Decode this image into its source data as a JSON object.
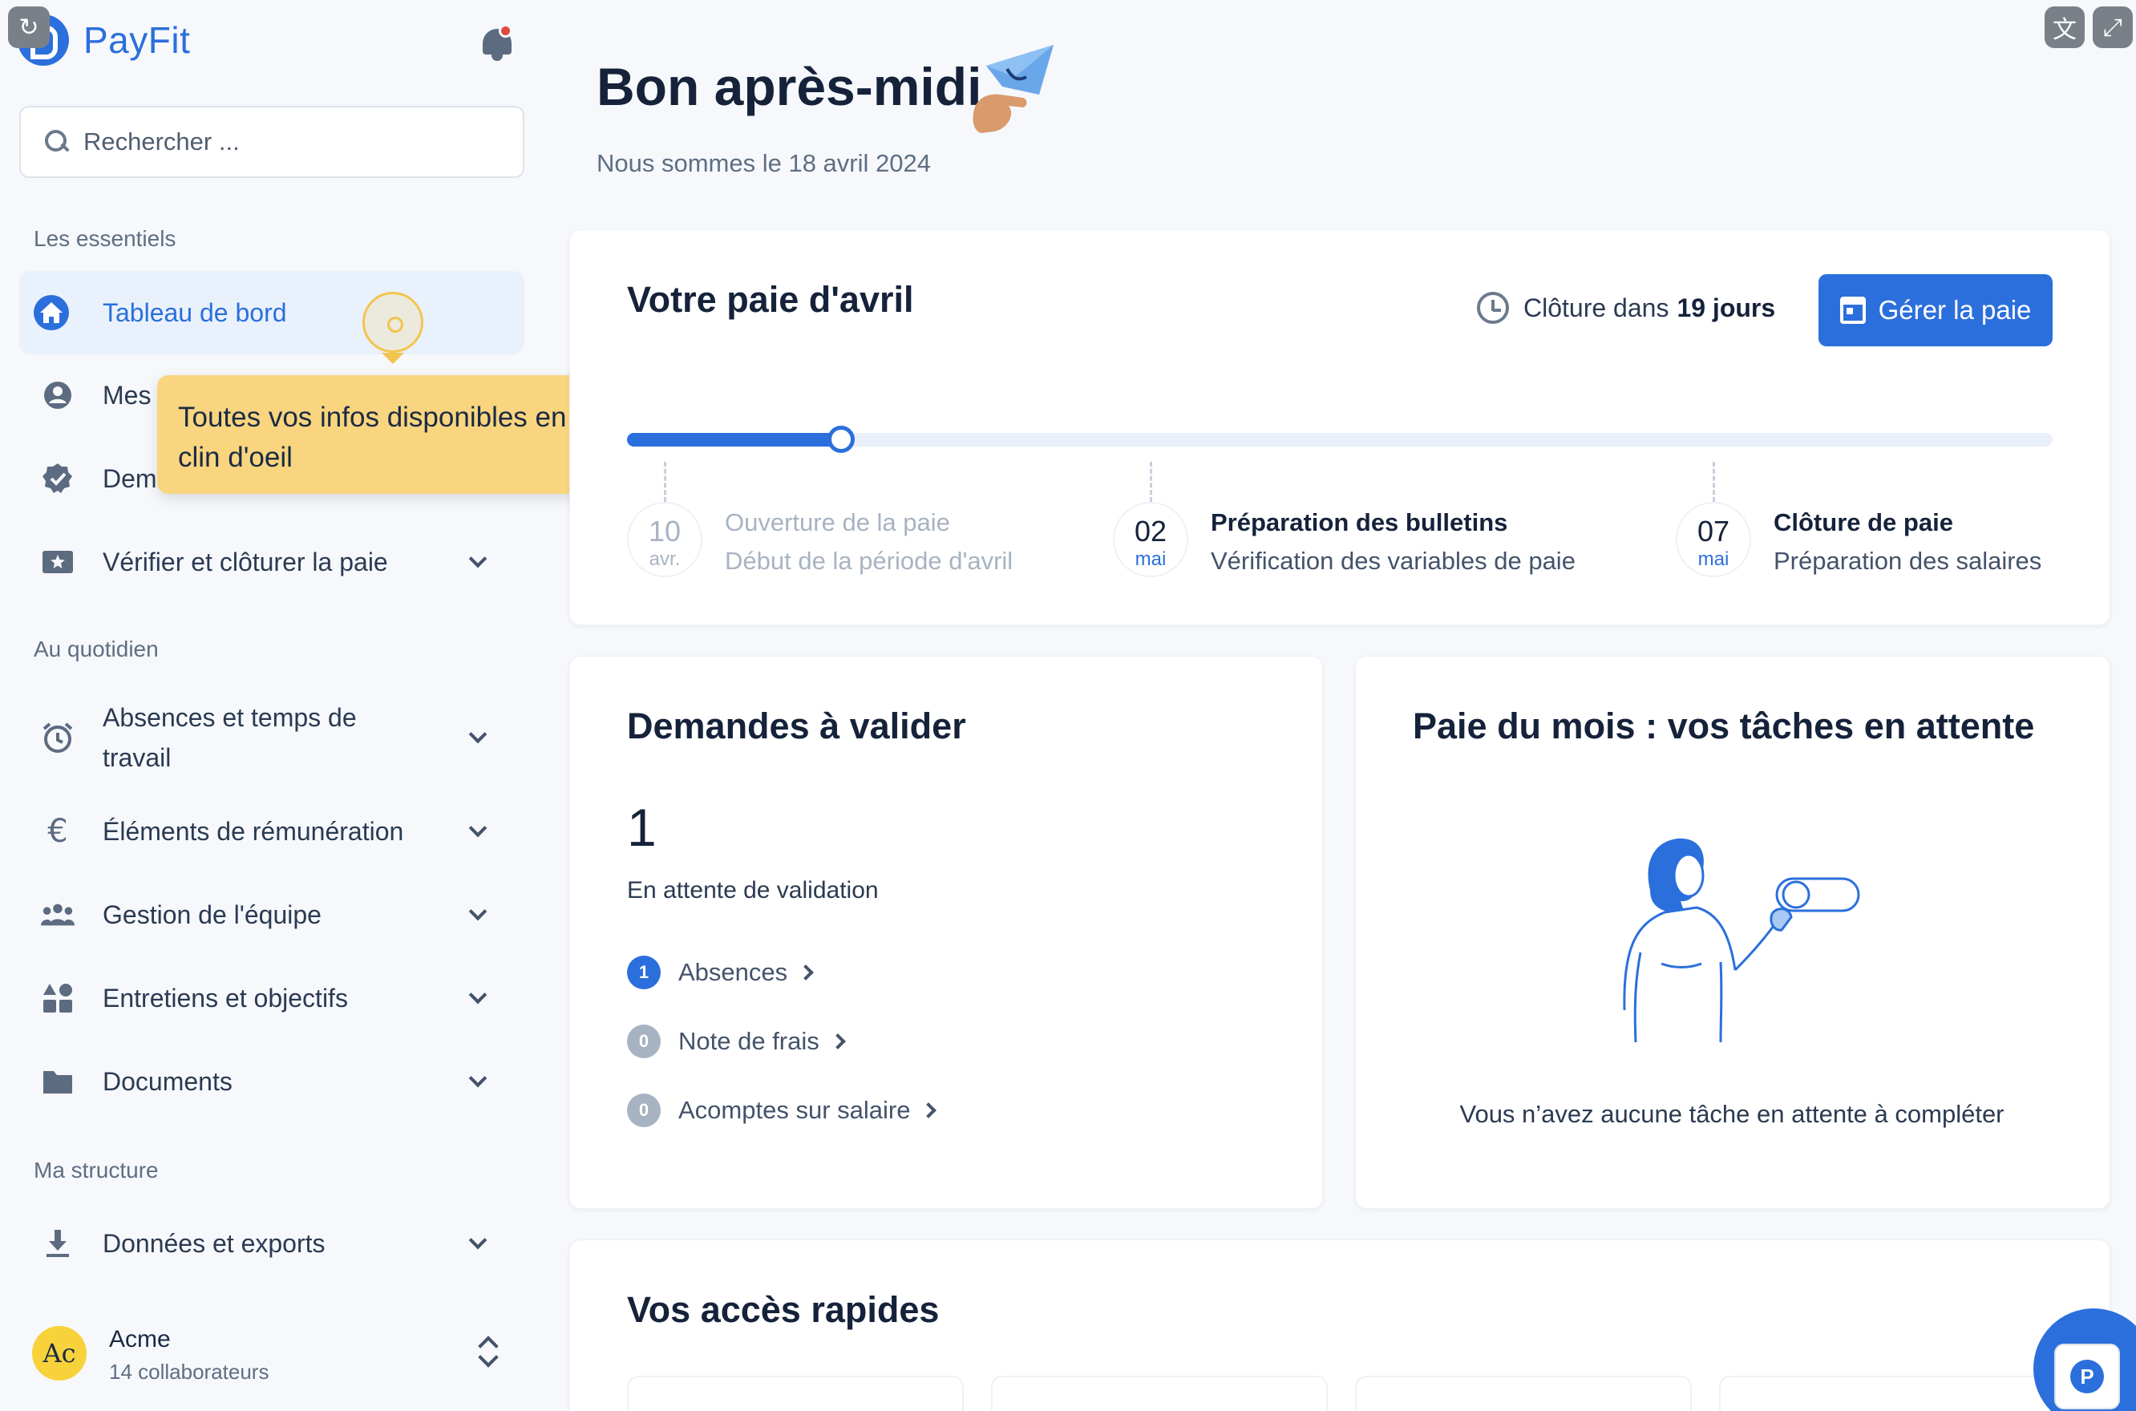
{
  "app": {
    "name": "PayFit"
  },
  "search": {
    "placeholder": "Rechercher ..."
  },
  "sidebar": {
    "sections": {
      "essentials": "Les essentiels",
      "daily": "Au quotidien",
      "structure": "Ma structure"
    },
    "items": [
      {
        "label": "Tableau de bord",
        "icon": "home-icon",
        "active": true
      },
      {
        "label": "Mes",
        "icon": "user-circle-icon"
      },
      {
        "label": "Dem",
        "icon": "check-badge-icon"
      },
      {
        "label": "Vérifier et clôturer la paie",
        "icon": "star-ticket-icon"
      },
      {
        "label": "Absences et temps de travail",
        "icon": "alarm-clock-icon"
      },
      {
        "label": "Éléments de rémunération",
        "icon": "euro-icon"
      },
      {
        "label": "Gestion de l'équipe",
        "icon": "team-icon"
      },
      {
        "label": "Entretiens et objectifs",
        "icon": "shapes-icon"
      },
      {
        "label": "Documents",
        "icon": "folder-icon"
      },
      {
        "label": "Données et exports",
        "icon": "download-icon"
      }
    ],
    "org": {
      "initials": "Ac",
      "name": "Acme",
      "members": "14 collaborateurs"
    }
  },
  "tooltip": {
    "text": "Toutes vos infos disponibles en un clin d'oeil"
  },
  "header": {
    "greeting": "Bon après-midi",
    "date": "Nous sommes le 18 avril 2024"
  },
  "payroll": {
    "title": "Votre paie d'avril",
    "closing_prefix": "Clôture dans",
    "closing_days": "19 jours",
    "button": "Gérer la paie",
    "progress": 0.15,
    "milestones": [
      {
        "day": "10",
        "month": "avr.",
        "title": "Ouverture de la paie",
        "subtitle": "Début de la période d'avril",
        "past": true
      },
      {
        "day": "02",
        "month": "mai",
        "title": "Préparation des bulletins",
        "subtitle": "Vérification des variables de paie",
        "past": false
      },
      {
        "day": "07",
        "month": "mai",
        "title": "Clôture de paie",
        "subtitle": "Préparation des salaires",
        "past": false
      }
    ]
  },
  "requests": {
    "title": "Demandes à valider",
    "count": "1",
    "count_label": "En attente de validation",
    "rows": [
      {
        "badge": "1",
        "label": "Absences",
        "color": "#2b6fdc"
      },
      {
        "badge": "0",
        "label": "Note de frais",
        "color": "#a8b3c2"
      },
      {
        "badge": "0",
        "label": "Acomptes sur salaire",
        "color": "#a8b3c2"
      }
    ]
  },
  "tasks": {
    "title": "Paie du mois : vos tâches en attente",
    "empty": "Vous n’avez aucune tâche en attente à compléter"
  },
  "quick": {
    "title": "Vos accès rapides"
  },
  "colors": {
    "accent": "#2b6fdc",
    "tooltip": "#f8d57e",
    "background": "#f6f8fb"
  }
}
